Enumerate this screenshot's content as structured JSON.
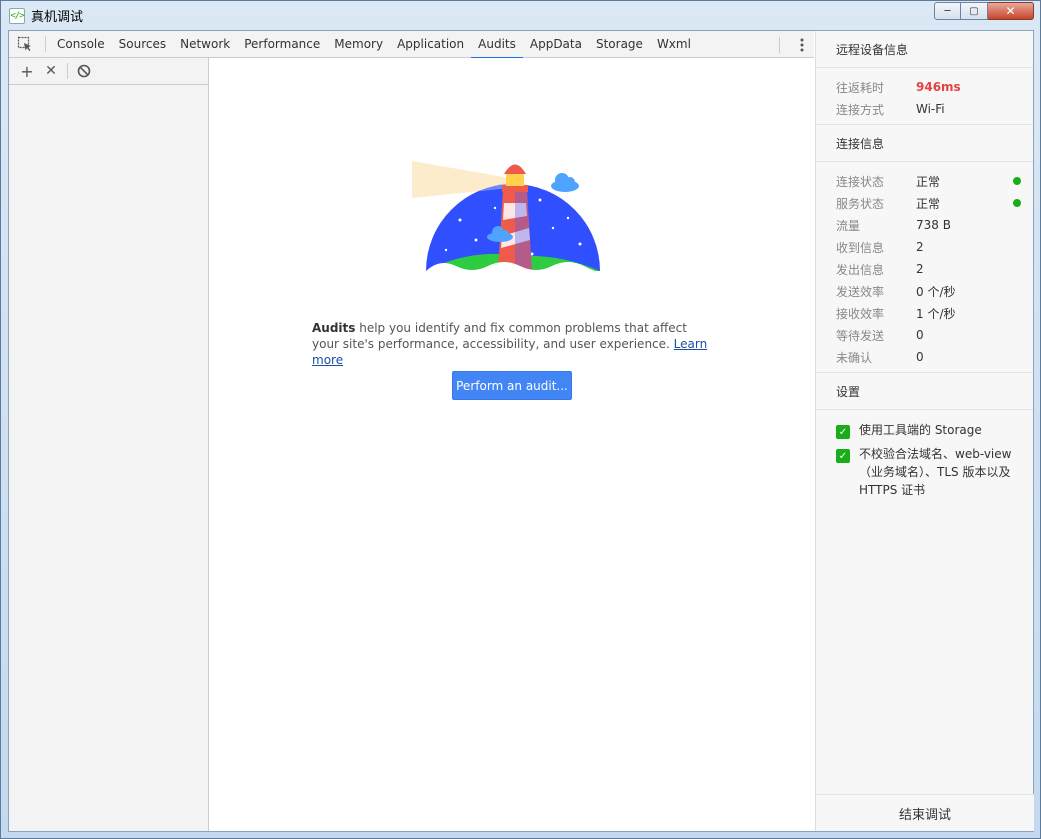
{
  "window": {
    "title": "真机调试",
    "app_icon": "code-brackets-icon",
    "min_glyph": "─",
    "max_glyph": "▢",
    "close_glyph": "✕"
  },
  "tabs": [
    {
      "label": "Console"
    },
    {
      "label": "Sources"
    },
    {
      "label": "Network"
    },
    {
      "label": "Performance"
    },
    {
      "label": "Memory"
    },
    {
      "label": "Application"
    },
    {
      "label": "Audits",
      "active": true
    },
    {
      "label": "AppData"
    },
    {
      "label": "Storage"
    },
    {
      "label": "Wxml"
    }
  ],
  "left_toolbar": {
    "add_glyph": "+",
    "clear_glyph": "✕",
    "block_glyph": "⃠"
  },
  "audits": {
    "bold_text": "Audits",
    "description": " help you identify and fix common problems that affect your site's performance, accessibility, and user experience. ",
    "learn_more": "Learn more",
    "perform_button": "Perform an audit..."
  },
  "right_panel": {
    "remote_title": "远程设备信息",
    "remote_rows": [
      {
        "label": "往返耗时",
        "value": "946ms"
      },
      {
        "label": "连接方式",
        "value": "Wi-Fi"
      }
    ],
    "connection_title": "连接信息",
    "connection_rows": [
      {
        "label": "连接状态",
        "value": "正常"
      },
      {
        "label": "服务状态",
        "value": "正常"
      },
      {
        "label": "流量",
        "value": "738 B"
      },
      {
        "label": "收到信息",
        "value": "2"
      },
      {
        "label": "发出信息",
        "value": "2"
      },
      {
        "label": "发送效率",
        "value": "0 个/秒"
      },
      {
        "label": "接收效率",
        "value": "1 个/秒"
      },
      {
        "label": "等待发送",
        "value": "0"
      },
      {
        "label": "未确认",
        "value": "0"
      }
    ],
    "settings_title": "设置",
    "settings": [
      {
        "label": "使用工具端的 Storage",
        "checked": true
      },
      {
        "label": "不校验合法域名、web-view（业务域名）、TLS 版本以及 HTTPS 证书",
        "checked": true
      }
    ],
    "end_button": "结束调试",
    "status_color": "#1aad19",
    "latency_color": "#e64340"
  }
}
